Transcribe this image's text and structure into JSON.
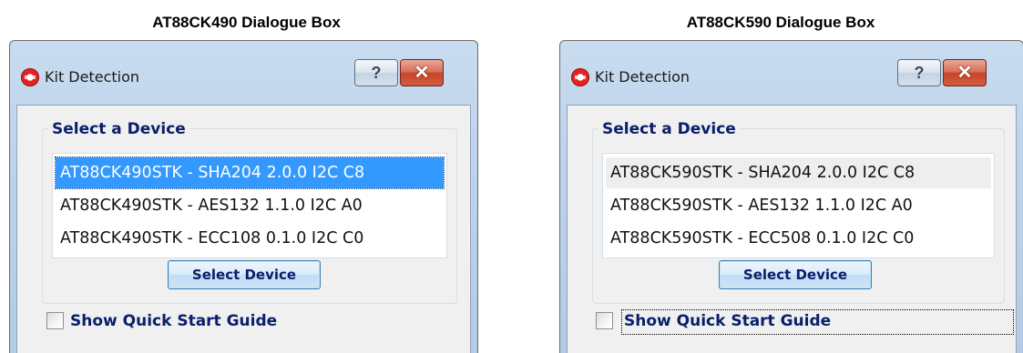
{
  "captions": {
    "left": "AT88CK490 Dialogue Box",
    "right": "AT88CK590 Dialogue Box"
  },
  "dialogs": [
    {
      "title": "Kit Detection",
      "help_label": "?",
      "close_label": "✕",
      "group_title": "Select a Device",
      "devices": [
        "AT88CK490STK - SHA204 2.0.0 I2C C8",
        "AT88CK490STK - AES132 1.1.0 I2C A0",
        "AT88CK490STK - ECC108 0.1.0 I2C C0"
      ],
      "selected_index": 0,
      "select_button": "Select Device",
      "checkbox_label": "Show Quick Start Guide",
      "checkbox_checked": false
    },
    {
      "title": "Kit Detection",
      "help_label": "?",
      "close_label": "✕",
      "group_title": "Select a Device",
      "devices": [
        "AT88CK590STK - SHA204 2.0.0 I2C C8",
        "AT88CK590STK - AES132 1.1.0 I2C A0",
        "AT88CK590STK - ECC508 0.1.0 I2C C0"
      ],
      "selected_index": null,
      "select_button": "Select Device",
      "checkbox_label": "Show Quick Start Guide",
      "checkbox_checked": false
    }
  ],
  "colors": {
    "selection": "#3399ff",
    "label_text": "#0a1e6b",
    "close_button": "#c7462b"
  },
  "icons": {
    "app": "atmel-app-icon",
    "help": "help-icon",
    "close": "close-icon"
  }
}
